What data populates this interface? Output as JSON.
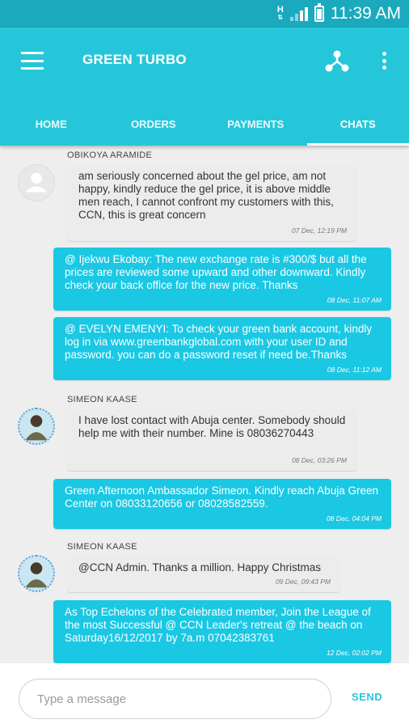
{
  "status_bar": {
    "network": "H",
    "time": "11:39 AM",
    "icons": [
      "network-type-icon",
      "signal-icon",
      "battery-icon"
    ]
  },
  "app_bar": {
    "title": "GREEN TURBO",
    "icons": [
      "menu-icon",
      "share-icon",
      "overflow-menu-icon"
    ],
    "color": "#26c6da"
  },
  "tabs": [
    {
      "label": "HOME",
      "active": false
    },
    {
      "label": "ORDERS",
      "active": false
    },
    {
      "label": "PAYMENTS",
      "active": false
    },
    {
      "label": "CHATS",
      "active": true
    }
  ],
  "messages": [
    {
      "type": "in",
      "sender": "OBIKOYA ARAMIDE",
      "avatar": "default-avatar-icon",
      "text": "am seriously concerned about the gel price, am not happy, kindly reduce the gel price, it is above middle men reach, I cannot confront my customers with this, CCN, this is great concern",
      "time": "07 Dec, 12:19 PM"
    },
    {
      "type": "out",
      "text": "@ Ijekwu Ekobay: The new exchange rate is #300/$ but all the prices are reviewed some upward and other downward. Kindly check your back office for the new price. Thanks",
      "time": "08 Dec, 11:07 AM"
    },
    {
      "type": "out",
      "text": "@ EVELYN EMENYI: To check your green bank account, kindly log in via www.greenbankglobal.com with your user ID and password. you can do a password reset if need be.Thanks",
      "time": "08 Dec, 11:12 AM"
    },
    {
      "type": "in",
      "sender": "SIMEON KAASE",
      "avatar": "user-photo",
      "text": "I have lost contact with Abuja center. Somebody should help me with their number. Mine is 08036270443",
      "time": "08 Dec, 03:26 PM"
    },
    {
      "type": "out",
      "text": "Green Afternoon Ambassador Simeon. Kindly reach Abuja Green Center on 08033120656  or 08028582559.",
      "time": "08 Dec, 04:04 PM"
    },
    {
      "type": "in",
      "sender": "SIMEON KAASE",
      "avatar": "user-photo",
      "text": "@CCN Admin. Thanks a million. Happy Christmas",
      "time": "09 Dec, 09:43 PM"
    },
    {
      "type": "out",
      "text": "As Top Echelons of the Celebrated member, Join the League of the most Successful @ CCN Leader's retreat @ the beach on Saturday16/12/2017 by 7a.m 07042383761",
      "time": "12 Dec, 02:02 PM"
    }
  ],
  "composer": {
    "placeholder": "Type a message",
    "value": "",
    "send_label": "SEND"
  }
}
